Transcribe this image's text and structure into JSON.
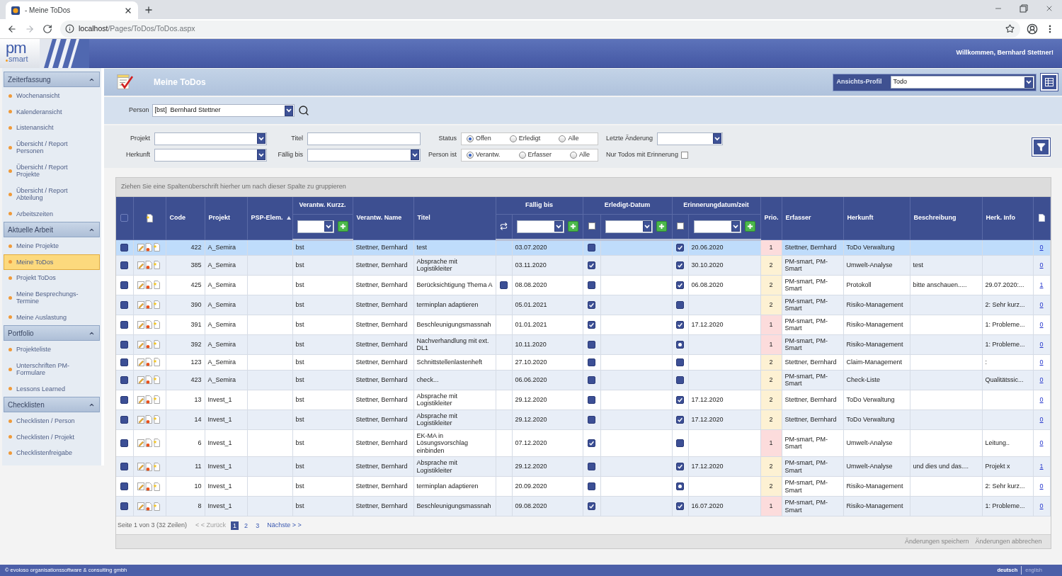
{
  "browser": {
    "tab_title": "- Meine ToDos",
    "url_host": "localhost",
    "url_path": "/Pages/ToDos/ToDos.aspx"
  },
  "header": {
    "logo_top": "pm",
    "logo_bottom": "smart",
    "welcome": "Willkommen, Bernhard Stettner!"
  },
  "sidebar": {
    "sections": [
      {
        "title": "Zeiterfassung",
        "expanded": true,
        "items": [
          {
            "label": "Wochenansicht",
            "selected": false
          },
          {
            "label": "Kalenderansicht",
            "selected": false
          },
          {
            "label": "Listenansicht",
            "selected": false
          },
          {
            "label": "Übersicht / Report Personen",
            "selected": false
          },
          {
            "label": "Übersicht / Report Projekte",
            "selected": false
          },
          {
            "label": "Übersicht / Report Abteilung",
            "selected": false
          },
          {
            "label": "Arbeitszeiten",
            "selected": false
          }
        ]
      },
      {
        "title": "Aktuelle Arbeit",
        "expanded": true,
        "items": [
          {
            "label": "Meine Projekte",
            "selected": false
          },
          {
            "label": "Meine ToDos",
            "selected": true
          },
          {
            "label": "Projekt ToDos",
            "selected": false
          },
          {
            "label": "Meine Besprechungs-Termine",
            "selected": false
          },
          {
            "label": "Meine Auslastung",
            "selected": false
          }
        ]
      },
      {
        "title": "Portfolio",
        "expanded": true,
        "items": [
          {
            "label": "Projekteliste",
            "selected": false
          },
          {
            "label": "Unterschriften PM-Formulare",
            "selected": false
          },
          {
            "label": "Lessons Learned",
            "selected": false
          }
        ]
      },
      {
        "title": "Checklisten",
        "expanded": true,
        "items": [
          {
            "label": "Checklisten / Person",
            "selected": false
          },
          {
            "label": "Checklisten / Projekt",
            "selected": false
          },
          {
            "label": "Checklistenfreigabe",
            "selected": false
          }
        ]
      }
    ]
  },
  "page": {
    "title": "Meine ToDos",
    "view_profile_label": "Ansichts-Profil",
    "view_profile_value": "Todo"
  },
  "person": {
    "label": "Person",
    "value": "[bst]  Bernhard Stettner"
  },
  "filters": {
    "project": {
      "label": "Projekt"
    },
    "title": {
      "label": "Titel"
    },
    "status": {
      "label": "Status",
      "options": [
        {
          "label": "Offen",
          "selected": true
        },
        {
          "label": "Erledigt",
          "selected": false
        },
        {
          "label": "Alle",
          "selected": false
        }
      ]
    },
    "last_change": {
      "label": "Letzte Änderung"
    },
    "origin": {
      "label": "Herkunft"
    },
    "due": {
      "label": "Fällig bis"
    },
    "person_role": {
      "label": "Person ist",
      "options": [
        {
          "label": "Verantw.",
          "selected": true
        },
        {
          "label": "Erfasser",
          "selected": false
        },
        {
          "label": "Alle",
          "selected": false
        }
      ]
    },
    "reminder_only": {
      "label": "Nur Todos mit Erinnerung",
      "checked": false
    }
  },
  "grid": {
    "group_hint": "Ziehen Sie eine Spaltenüberschrift hierher um nach dieser Spalte zu gruppieren",
    "select_all": {
      "checked": false
    },
    "columns": [
      {
        "label": "Code",
        "kind": "plain"
      },
      {
        "label": "Projekt",
        "kind": "plain"
      },
      {
        "label": "PSP-Elem.",
        "kind": "plain",
        "sorted": true
      },
      {
        "label": "Verantw. Kurzz.",
        "kind": "filter"
      },
      {
        "label": "Verantw. Name",
        "kind": "plain"
      },
      {
        "label": "Titel",
        "kind": "plain"
      },
      {
        "label": "Fällig bis",
        "kind": "date_filter",
        "toggle": {
          "kind": "swap"
        }
      },
      {
        "label": "Erledigt-Datum",
        "kind": "date_filter",
        "toggle": {
          "kind": "checkbox",
          "checked": false
        }
      },
      {
        "label": "Erinnerungdatum/zeit",
        "kind": "date_filter",
        "toggle": {
          "kind": "checkbox",
          "checked": false
        }
      },
      {
        "label": "Prio.",
        "kind": "plain"
      },
      {
        "label": "Erfasser",
        "kind": "plain"
      },
      {
        "label": "Herkunft",
        "kind": "plain"
      },
      {
        "label": "Beschreibung",
        "kind": "plain"
      },
      {
        "label": "Herk. Info",
        "kind": "plain"
      }
    ],
    "rows": [
      {
        "selected": true,
        "checked": false,
        "code": "422",
        "project": "A_Semira",
        "owner_short": "bst",
        "owner_name": "Stettner, Bernhard",
        "title": "test",
        "due": "03.07.2020",
        "done": false,
        "reminder": true,
        "reminder_date": "20.06.2020",
        "prio": "1",
        "color": "#fcdcdc",
        "creator": "Stettner, Bernhard",
        "origin": "ToDo Verwaltung",
        "attachments": "0"
      },
      {
        "selected": false,
        "checked": false,
        "code": "385",
        "project": "A_Semira",
        "owner_short": "bst",
        "owner_name": "Stettner, Bernhard",
        "title": "Absprache mit Logistikleiter",
        "due": "03.11.2020",
        "done": true,
        "reminder": true,
        "reminder_date": "30.10.2020",
        "prio": "2",
        "color": "#fdf1d3",
        "creator": "PM-smart, PM-Smart",
        "origin": "Umwelt-Analyse",
        "description": "test",
        "attachments": "0"
      },
      {
        "selected": false,
        "checked": false,
        "code": "425",
        "project": "A_Semira",
        "owner_short": "bst",
        "owner_name": "Stettner, Bernhard",
        "title": "Berücksichtigung Thema A",
        "due_checkbox": {
          "checked": false
        },
        "due": "08.08.2020",
        "done": false,
        "reminder": true,
        "reminder_date": "06.08.2020",
        "prio": "2",
        "color": "#fdf1d3",
        "creator": "PM-smart, PM-Smart",
        "origin": "Protokoll",
        "description": "bitte anschauen.....",
        "origin_info": "29.07.2020:...",
        "attachments": "1"
      },
      {
        "selected": false,
        "checked": false,
        "code": "390",
        "project": "A_Semira",
        "owner_short": "bst",
        "owner_name": "Stettner, Bernhard",
        "title": "terminplan adaptieren",
        "due": "05.01.2021",
        "done": true,
        "reminder": false,
        "prio": "2",
        "color": "#fdf1d3",
        "creator": "PM-smart, PM-Smart",
        "origin": "Risiko-Management",
        "origin_info": "2: Sehr kurz...",
        "attachments": "0"
      },
      {
        "selected": false,
        "checked": false,
        "code": "391",
        "project": "A_Semira",
        "owner_short": "bst",
        "owner_name": "Stettner, Bernhard",
        "title": "Beschleunigungsmassnah",
        "due": "01.01.2021",
        "done": true,
        "reminder": true,
        "reminder_date": "17.12.2020",
        "prio": "1",
        "color": "#fcdcdc",
        "creator": "PM-smart, PM-Smart",
        "origin": "Risiko-Management",
        "origin_info": "1: Probleme...",
        "attachments": "0"
      },
      {
        "selected": false,
        "checked": false,
        "code": "392",
        "project": "A_Semira",
        "owner_short": "bst",
        "owner_name": "Stettner, Bernhard",
        "title": "Nachverhandlung mit ext. DL1",
        "due": "10.11.2020",
        "done": false,
        "reminder": true,
        "reminder_dot": true,
        "prio": "1",
        "color": "#fcdcdc",
        "creator": "PM-smart, PM-Smart",
        "origin": "Risiko-Management",
        "origin_info": "1: Probleme...",
        "attachments": "0"
      },
      {
        "selected": false,
        "checked": false,
        "code": "123",
        "project": "A_Semira",
        "owner_short": "bst",
        "owner_name": "Stettner, Bernhard",
        "title": "Schnittstellenlastenheft",
        "due": "27.10.2020",
        "done": false,
        "reminder": false,
        "prio": "2",
        "color": "#fdf1d3",
        "creator": "Stettner, Bernhard",
        "origin": "Claim-Management",
        "origin_info": ":",
        "attachments": "0"
      },
      {
        "selected": false,
        "checked": false,
        "code": "423",
        "project": "A_Semira",
        "owner_short": "bst",
        "owner_name": "Stettner, Bernhard",
        "title": "check...",
        "due": "06.06.2020",
        "done": false,
        "reminder": false,
        "prio": "2",
        "color": "#fdf1d3",
        "creator": "PM-smart, PM-Smart",
        "origin": "Check-Liste",
        "origin_info": "Qualitätssic...",
        "attachments": "0"
      },
      {
        "selected": false,
        "checked": false,
        "code": "13",
        "project": "Invest_1",
        "owner_short": "bst",
        "owner_name": "Stettner, Bernhard",
        "title": "Absprache mit Logistikleiter",
        "due": "29.12.2020",
        "done": false,
        "reminder": true,
        "reminder_date": "17.12.2020",
        "prio": "2",
        "color": "#fdf1d3",
        "creator": "Stettner, Bernhard",
        "origin": "ToDo Verwaltung",
        "attachments": "0"
      },
      {
        "selected": false,
        "checked": false,
        "code": "14",
        "project": "Invest_1",
        "owner_short": "bst",
        "owner_name": "Stettner, Bernhard",
        "title": "Absprache mit Logistikleiter",
        "due": "29.12.2020",
        "done": false,
        "reminder": true,
        "reminder_date": "17.12.2020",
        "prio": "2",
        "color": "#fdf1d3",
        "creator": "Stettner, Bernhard",
        "origin": "ToDo Verwaltung",
        "attachments": "0"
      },
      {
        "selected": false,
        "checked": false,
        "code": "6",
        "project": "Invest_1",
        "owner_short": "bst",
        "owner_name": "Stettner, Bernhard",
        "title": "EK-MA in Lösungsvorschlag einbinden",
        "due": "07.12.2020",
        "done": true,
        "reminder": false,
        "prio": "1",
        "color": "#fcdcdc",
        "creator": "PM-smart, PM-Smart",
        "origin": "Umwelt-Analyse",
        "origin_info": "Leitung..",
        "attachments": "0"
      },
      {
        "selected": false,
        "checked": false,
        "code": "11",
        "project": "Invest_1",
        "owner_short": "bst",
        "owner_name": "Stettner, Bernhard",
        "title": "Absprache mit Logistikleiter",
        "due": "29.12.2020",
        "done": false,
        "reminder": true,
        "reminder_date": "17.12.2020",
        "prio": "2",
        "color": "#fdf1d3",
        "creator": "PM-smart, PM-Smart",
        "origin": "Umwelt-Analyse",
        "description": "und dies und das....",
        "origin_info": "Projekt x",
        "attachments": "1"
      },
      {
        "selected": false,
        "checked": false,
        "code": "10",
        "project": "Invest_1",
        "owner_short": "bst",
        "owner_name": "Stettner, Bernhard",
        "title": "terminplan adaptieren",
        "due": "20.09.2020",
        "done": false,
        "reminder": true,
        "reminder_dot": true,
        "prio": "2",
        "color": "#fdf1d3",
        "creator": "PM-smart, PM-Smart",
        "origin": "Risiko-Management",
        "origin_info": "2: Sehr kurz...",
        "attachments": "0"
      },
      {
        "selected": false,
        "checked": false,
        "code": "8",
        "project": "Invest_1",
        "owner_short": "bst",
        "owner_name": "Stettner, Bernhard",
        "title": "Beschleunigungsmassnah",
        "due": "09.08.2020",
        "done": true,
        "reminder": true,
        "reminder_date": "16.07.2020",
        "prio": "1",
        "color": "#fcdcdc",
        "creator": "PM-smart, PM-Smart",
        "origin": "Risiko-Management",
        "origin_info": "1: Probleme...",
        "attachments": "0"
      }
    ],
    "pager": {
      "summary": "Seite 1 von 3 (32 Zeilen)",
      "prev": {
        "label": "< < Zurück",
        "disabled": true
      },
      "pages": [
        {
          "label": "1",
          "selected": true
        },
        {
          "label": "2",
          "selected": false
        },
        {
          "label": "3",
          "selected": false
        }
      ],
      "next": {
        "label": "Nächste > >",
        "disabled": false
      }
    },
    "actions": [
      {
        "label": "Änderungen speichern",
        "disabled": true
      },
      {
        "label": "Änderungen abbrechen",
        "disabled": true
      }
    ]
  },
  "footer": {
    "copyright": "© evoloso organisationssoftware & consulting gmbh",
    "languages": [
      {
        "label": "deutsch",
        "selected": true
      },
      {
        "label": "english",
        "selected": false
      }
    ]
  }
}
